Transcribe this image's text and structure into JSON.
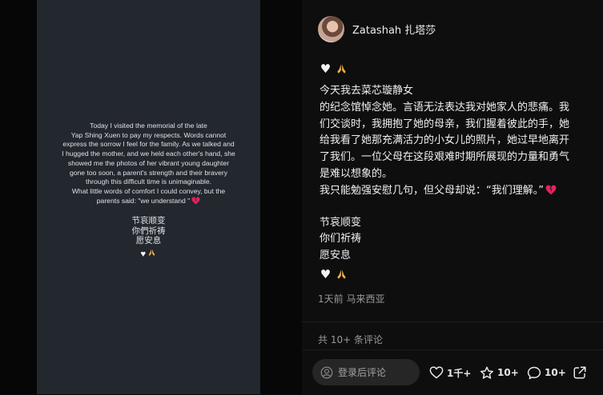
{
  "media": {
    "lines": [
      "Today I visited the memorial of the late",
      "Yap Shing Xuen to pay my respects.  Words cannot",
      "express the sorrow I feel for the family. As we talked and",
      "I hugged the mother, and we held each other's hand, she",
      "showed me the photos of her vibrant young daughter",
      "gone too soon, a parent's strength and their bravery",
      "through this difficult time is unimaginable.",
      "What little words of comfort I could convey, but the",
      "parents said: \"we understand \""
    ],
    "cn_lines": [
      "节哀顺变",
      "你們祈祷",
      "愿安息"
    ]
  },
  "post": {
    "username": "Zatashah 扎塔莎",
    "lines": [
      "今天我去菜芯璇静女",
      "的纪念馆悼念她。言语无法表达我对她家人的悲痛。我",
      "们交谈时，我拥抱了她的母亲，我们握着彼此的手，她",
      "给我看了她那充满活力的小女儿的照片，她过早地离开",
      "了我们。一位父母在这段艰难时期所展现的力量和勇气",
      "是难以想象的。",
      "我只能勉强安慰几句，但父母却说：“我们理解。”"
    ],
    "closing_lines": [
      "节哀顺变",
      "你们祈祷",
      "愿安息"
    ],
    "timestamp": "1天前 马来西亚",
    "comments_count": "共 10+ 条评论"
  },
  "bottom_bar": {
    "comment_placeholder": "登录后评论",
    "likes": "1千+",
    "favorites": "10+",
    "comments": "10+"
  },
  "icons": {
    "avatar": "avatar",
    "white-heart": "white-heart-icon",
    "folded-hands": "folded-hands-icon",
    "broken-heart": "broken-heart-icon",
    "user": "user-icon",
    "like": "heart-outline-icon",
    "favorite": "star-outline-icon",
    "comment": "comment-bubble-icon",
    "share": "share-icon"
  },
  "colors": {
    "media_bg": "#23272e",
    "panel_bg": "#0e0e0e",
    "broken_heart": "#e0245e"
  }
}
